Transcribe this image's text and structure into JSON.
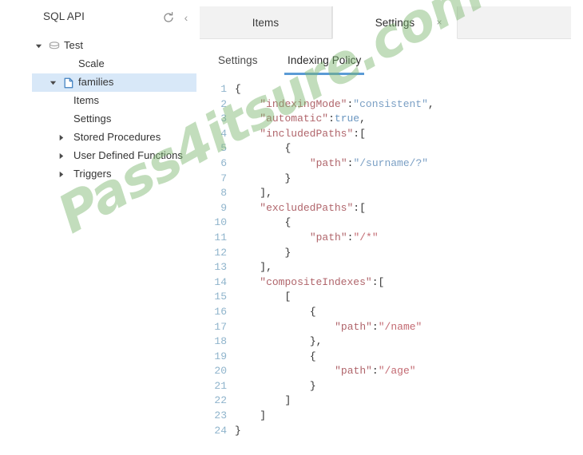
{
  "explorer": {
    "title": "SQL API",
    "refresh_icon": "refresh-icon",
    "collapse_icon": "chevron-left-icon",
    "tree": [
      {
        "label": "Test",
        "icon": "database-icon",
        "twisty": "expanded",
        "indent": 0,
        "selected": false
      },
      {
        "label": "Scale",
        "icon": "none",
        "twisty": "none",
        "indent": 1,
        "selected": false
      },
      {
        "label": "families",
        "icon": "container-icon",
        "twisty": "expanded",
        "indent": 1,
        "selected": true
      },
      {
        "label": "Items",
        "icon": "none",
        "twisty": "none",
        "indent": 2,
        "selected": false
      },
      {
        "label": "Settings",
        "icon": "none",
        "twisty": "none",
        "indent": 2,
        "selected": false
      },
      {
        "label": "Stored Procedures",
        "icon": "none",
        "twisty": "collapsed",
        "indent": 2,
        "selected": false
      },
      {
        "label": "User Defined Functions",
        "icon": "none",
        "twisty": "collapsed",
        "indent": 2,
        "selected": false
      },
      {
        "label": "Triggers",
        "icon": "none",
        "twisty": "collapsed",
        "indent": 2,
        "selected": false
      }
    ]
  },
  "document_tabs": {
    "items_label": "Items",
    "settings_label": "Settings",
    "close_glyph": "×",
    "active": "Settings"
  },
  "sub_tabs": {
    "settings_label": "Settings",
    "indexing_policy_label": "Indexing Policy",
    "active": "Indexing Policy"
  },
  "editor": {
    "lines": [
      {
        "n": "1",
        "indent": 0,
        "tokens": [
          {
            "t": "{",
            "c": "p"
          }
        ]
      },
      {
        "n": "2",
        "indent": 1,
        "tokens": [
          {
            "t": "\"indexingMode\"",
            "c": "k"
          },
          {
            "t": ":",
            "c": "p"
          },
          {
            "t": "\"consistent\"",
            "c": "s"
          },
          {
            "t": ",",
            "c": "p"
          }
        ]
      },
      {
        "n": "3",
        "indent": 1,
        "tokens": [
          {
            "t": "\"automatic\"",
            "c": "k"
          },
          {
            "t": ":",
            "c": "p"
          },
          {
            "t": "true",
            "c": "b"
          },
          {
            "t": ",",
            "c": "p"
          }
        ]
      },
      {
        "n": "4",
        "indent": 1,
        "tokens": [
          {
            "t": "\"includedPaths\"",
            "c": "k"
          },
          {
            "t": ":",
            "c": "p"
          },
          {
            "t": "[",
            "c": "p"
          }
        ]
      },
      {
        "n": "5",
        "indent": 2,
        "tokens": [
          {
            "t": "{",
            "c": "p"
          }
        ]
      },
      {
        "n": "6",
        "indent": 3,
        "tokens": [
          {
            "t": "\"path\"",
            "c": "k"
          },
          {
            "t": ":",
            "c": "p"
          },
          {
            "t": "\"/surname/?\"",
            "c": "s"
          }
        ]
      },
      {
        "n": "7",
        "indent": 2,
        "tokens": [
          {
            "t": "}",
            "c": "p"
          }
        ]
      },
      {
        "n": "8",
        "indent": 1,
        "tokens": [
          {
            "t": "],",
            "c": "p"
          }
        ]
      },
      {
        "n": "9",
        "indent": 1,
        "tokens": [
          {
            "t": "\"excludedPaths\"",
            "c": "k"
          },
          {
            "t": ":",
            "c": "p"
          },
          {
            "t": "[",
            "c": "p"
          }
        ]
      },
      {
        "n": "10",
        "indent": 2,
        "tokens": [
          {
            "t": "{",
            "c": "p"
          }
        ]
      },
      {
        "n": "11",
        "indent": 3,
        "tokens": [
          {
            "t": "\"path\"",
            "c": "k"
          },
          {
            "t": ":",
            "c": "p"
          },
          {
            "t": "\"/*\"",
            "c": "sr"
          }
        ]
      },
      {
        "n": "12",
        "indent": 2,
        "tokens": [
          {
            "t": "}",
            "c": "p"
          }
        ]
      },
      {
        "n": "13",
        "indent": 1,
        "tokens": [
          {
            "t": "],",
            "c": "p"
          }
        ]
      },
      {
        "n": "14",
        "indent": 1,
        "tokens": [
          {
            "t": "\"compositeIndexes\"",
            "c": "k"
          },
          {
            "t": ":",
            "c": "p"
          },
          {
            "t": "[",
            "c": "p"
          }
        ]
      },
      {
        "n": "15",
        "indent": 2,
        "tokens": [
          {
            "t": "[",
            "c": "p"
          }
        ]
      },
      {
        "n": "16",
        "indent": 3,
        "tokens": [
          {
            "t": "{",
            "c": "p"
          }
        ]
      },
      {
        "n": "17",
        "indent": 4,
        "tokens": [
          {
            "t": "\"path\"",
            "c": "k"
          },
          {
            "t": ":",
            "c": "p"
          },
          {
            "t": "\"/name\"",
            "c": "sr"
          }
        ]
      },
      {
        "n": "18",
        "indent": 3,
        "tokens": [
          {
            "t": "},",
            "c": "p"
          }
        ]
      },
      {
        "n": "19",
        "indent": 3,
        "tokens": [
          {
            "t": "{",
            "c": "p"
          }
        ]
      },
      {
        "n": "20",
        "indent": 4,
        "tokens": [
          {
            "t": "\"path\"",
            "c": "k"
          },
          {
            "t": ":",
            "c": "p"
          },
          {
            "t": "\"/age\"",
            "c": "sr"
          }
        ]
      },
      {
        "n": "21",
        "indent": 3,
        "tokens": [
          {
            "t": "}",
            "c": "p"
          }
        ]
      },
      {
        "n": "22",
        "indent": 2,
        "tokens": [
          {
            "t": "]",
            "c": "p"
          }
        ]
      },
      {
        "n": "23",
        "indent": 1,
        "tokens": [
          {
            "t": "]",
            "c": "p"
          }
        ]
      },
      {
        "n": "24",
        "indent": 0,
        "tokens": [
          {
            "t": "}",
            "c": "p"
          }
        ]
      }
    ]
  },
  "watermark": {
    "text": "Pass4itsure.com",
    "color": "#7ab46e"
  },
  "colors": {
    "selection": "#d8e8f8",
    "accent_underline": "#5b9bd5",
    "tabstrip_bg": "#f2f2f2",
    "line_number": "#8fb4cc",
    "json_key": "#b0656b",
    "json_string": "#7a9fc4"
  }
}
